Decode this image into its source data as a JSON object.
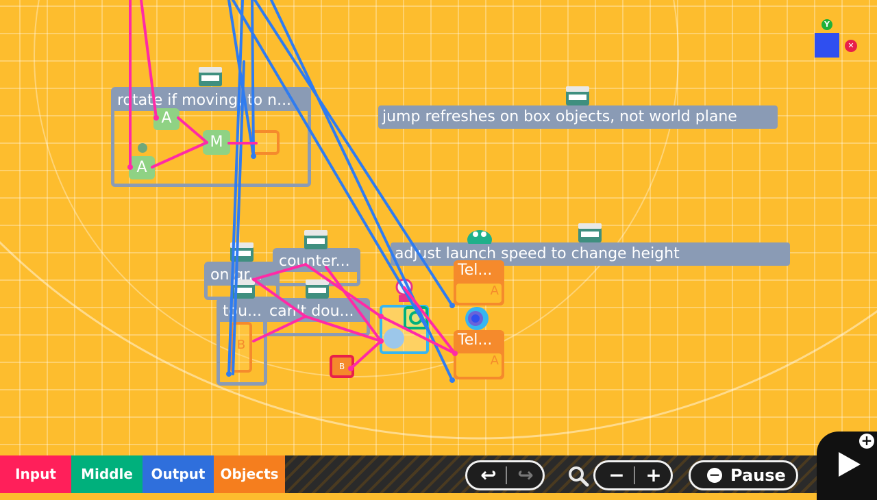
{
  "comments": {
    "jump": "jump refreshes on box objects, not world plane",
    "adjust": "adjust launch speed to change height"
  },
  "groups": {
    "rotate": "rotate if moving, to n...",
    "on_ground": "on gr...",
    "counter": "counter...",
    "touch": "tou...",
    "cant_double": "can't dou..."
  },
  "nodes": {
    "a1": "A",
    "a2": "A",
    "m": "M",
    "tel_top": "Tel...",
    "tel_top_port": "A",
    "tel_bottom": "Tel...",
    "tel_bottom_port": "A",
    "b": "B",
    "coin": "B"
  },
  "gizmo": {
    "y_label": "Y",
    "x_label": "✕"
  },
  "toolbar": {
    "tabs": [
      {
        "label": "Input",
        "color": "#ff1f5a"
      },
      {
        "label": "Middle",
        "color": "#00b07c"
      },
      {
        "label": "Output",
        "color": "#2f6fdc"
      },
      {
        "label": "Objects",
        "color": "#f57e1e"
      }
    ],
    "undo_icon": "↩",
    "redo_icon": "↪",
    "zoom_out": "−",
    "zoom_in": "+",
    "pause_label": "Pause",
    "pause_icon": "−",
    "play_icon": "play-icon",
    "plus_icon": "+"
  },
  "colors": {
    "canvas": "#fdbd2e",
    "wire_pink": "#ff2aa6",
    "wire_blue": "#2f7cf0",
    "comment_bg": "#8a9bb5",
    "node_orange": "#f58a2c",
    "node_green": "#8fd284"
  }
}
